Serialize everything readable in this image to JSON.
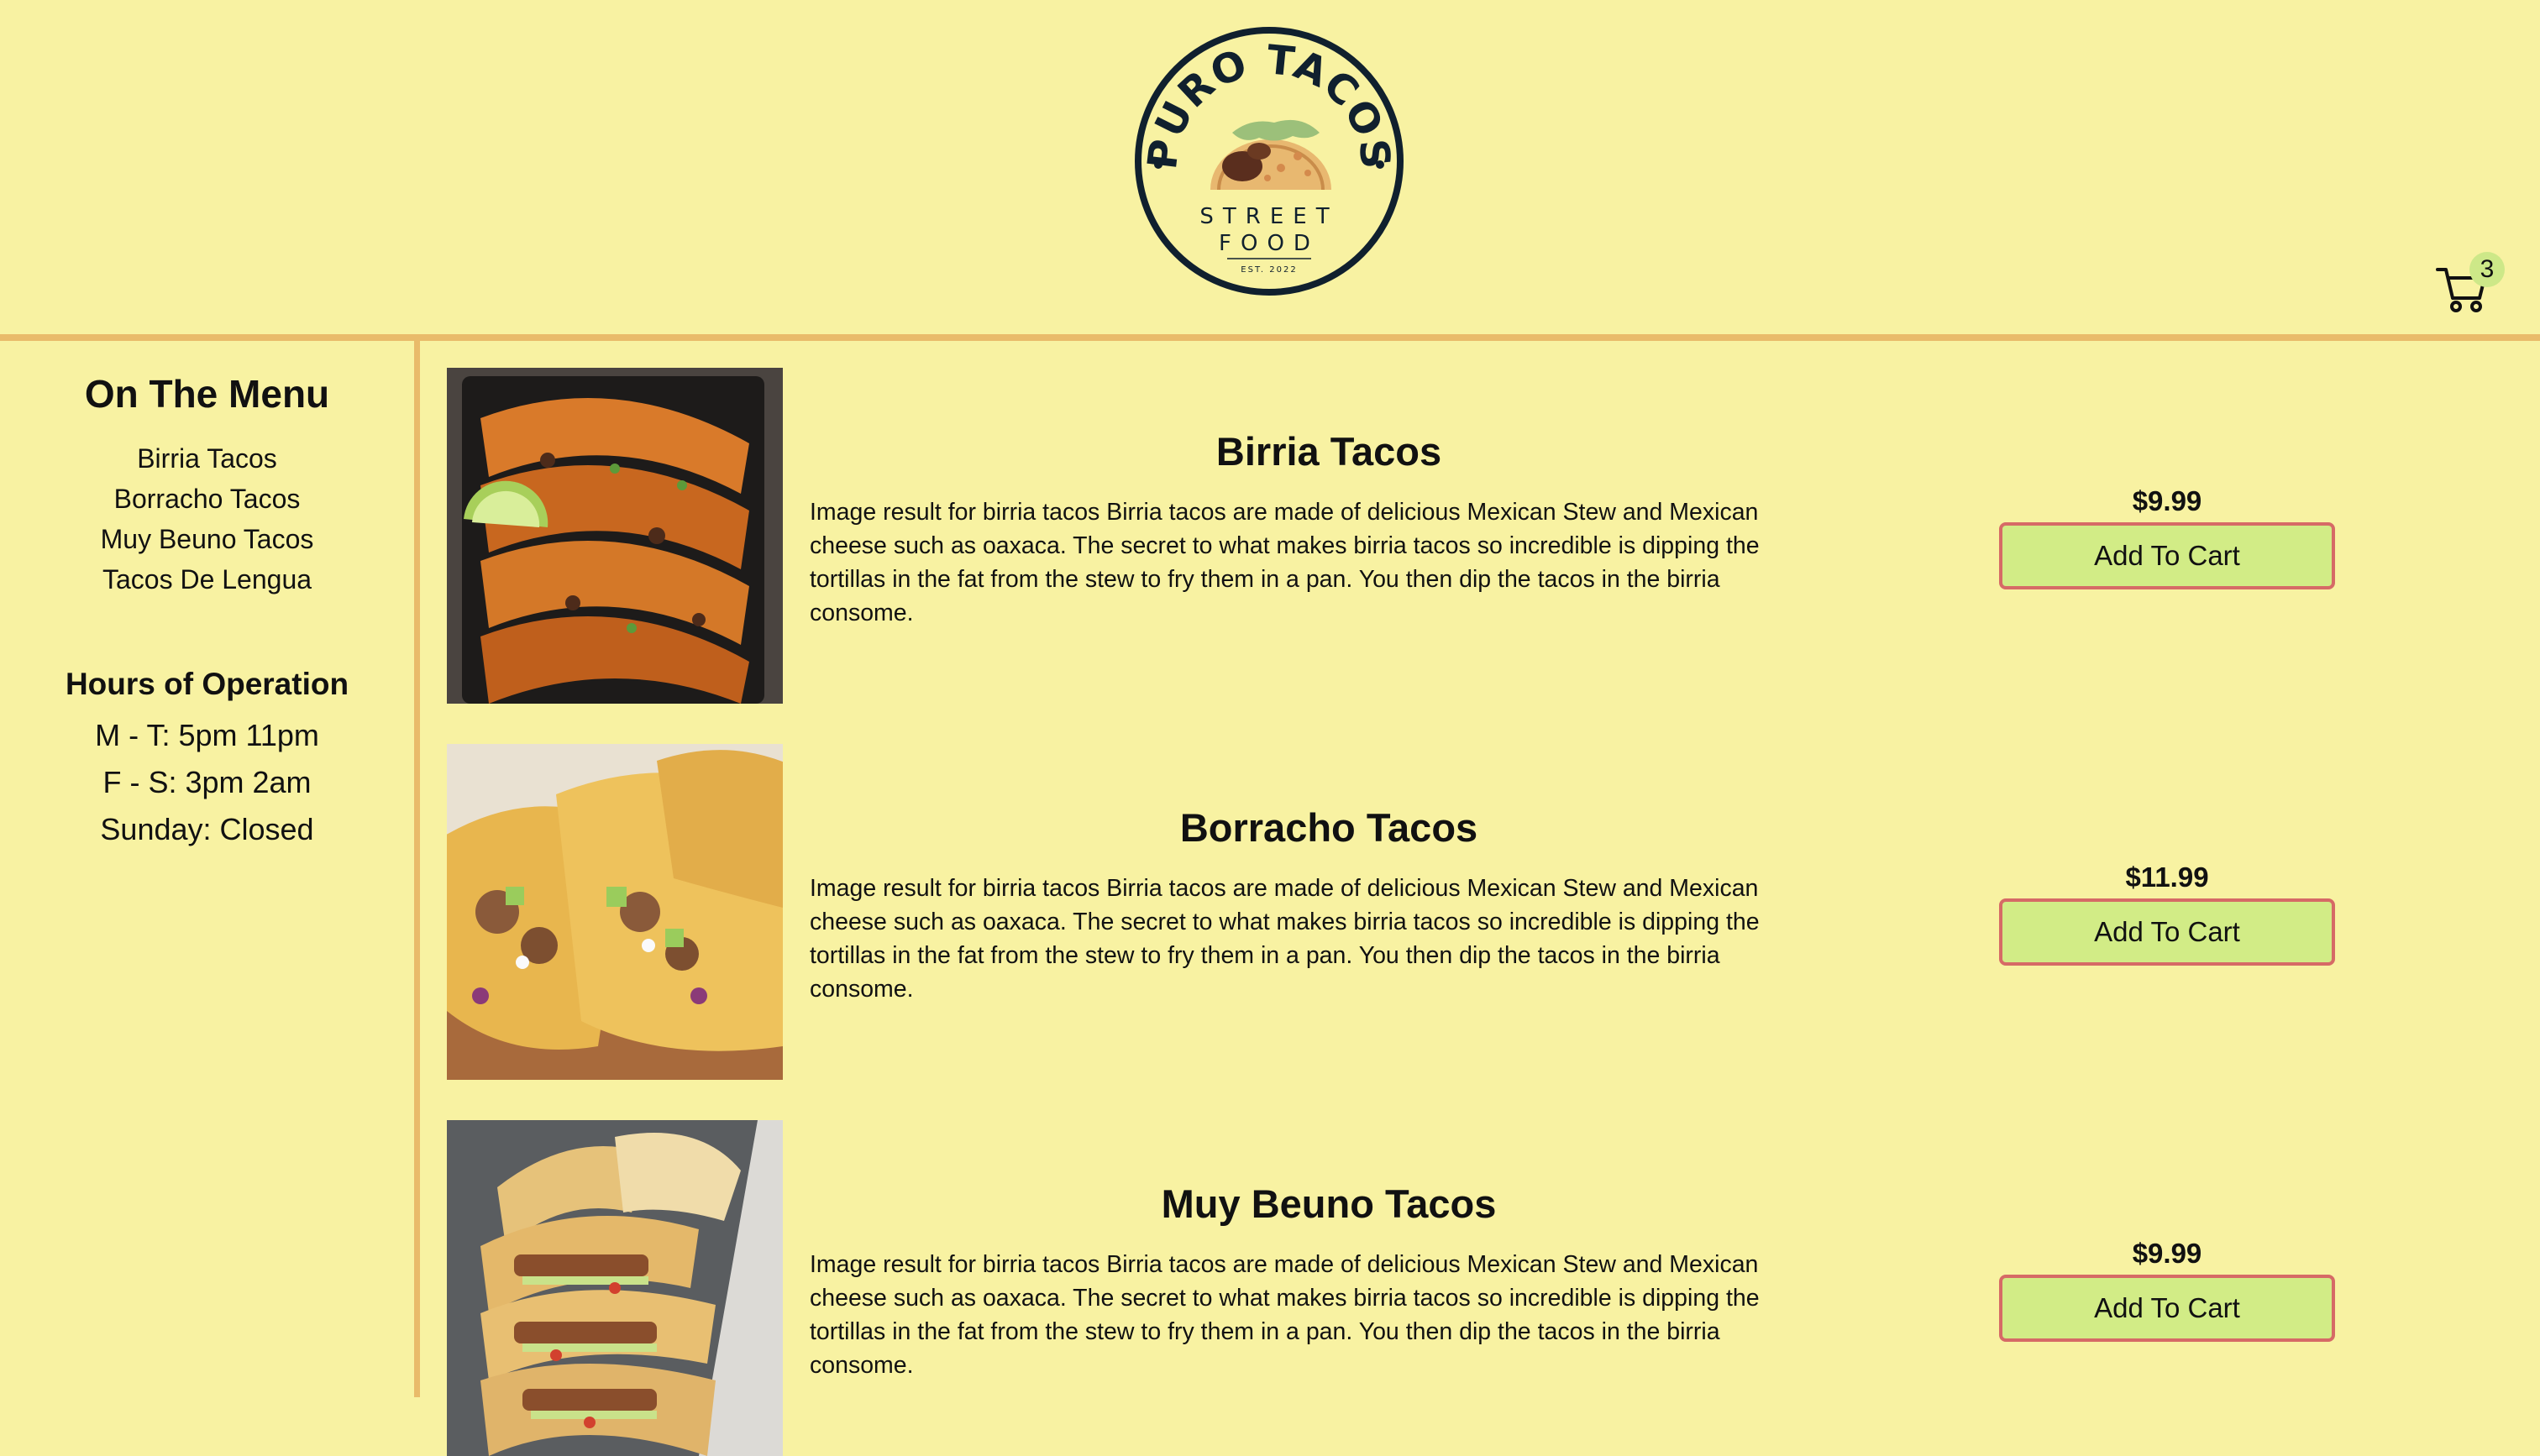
{
  "header": {
    "logo": {
      "top_text": "PURO TACOS",
      "line1": "STREET",
      "line2": "FOOD",
      "est": "EST. 2022"
    },
    "cart": {
      "icon": "cart-icon",
      "count": "3"
    }
  },
  "sidebar": {
    "menu_title": "On The Menu",
    "menu_items": [
      {
        "label": "Birria Tacos"
      },
      {
        "label": "Borracho Tacos"
      },
      {
        "label": "Muy Beuno Tacos"
      },
      {
        "label": "Tacos De Lengua"
      }
    ],
    "hours_title": "Hours of Operation",
    "hours": [
      {
        "text": "M - T: 5pm 11pm"
      },
      {
        "text": "F - S: 3pm 2am"
      },
      {
        "text": "Sunday: Closed"
      }
    ]
  },
  "items": [
    {
      "title": "Birria Tacos",
      "description": "Image result for birria tacos Birria tacos are made of delicious Mexican Stew and Mexican cheese such as oaxaca. The secret to what makes birria tacos so incredible is dipping the tortillas in the fat from the stew to fry them in a pan. You then dip the tacos in the birria consome.",
      "price": "$9.99",
      "button_label": "Add To Cart"
    },
    {
      "title": "Borracho Tacos",
      "description": "Image result for birria tacos Birria tacos are made of delicious Mexican Stew and Mexican cheese such as oaxaca. The secret to what makes birria tacos so incredible is dipping the tortillas in the fat from the stew to fry them in a pan. You then dip the tacos in the birria consome.",
      "price": "$11.99",
      "button_label": "Add To Cart"
    },
    {
      "title": "Muy Beuno Tacos",
      "description": "Image result for birria tacos Birria tacos are made of delicious Mexican Stew and Mexican cheese such as oaxaca. The secret to what makes birria tacos so incredible is dipping the tortillas in the fat from the stew to fry them in a pan. You then dip the tacos in the birria consome.",
      "price": "$9.99",
      "button_label": "Add To Cart"
    }
  ],
  "colors": {
    "background": "#f8f2a2",
    "rule": "#e9bb6a",
    "button_fill": "#d2ec86",
    "button_border": "#d66a66",
    "badge": "#cde888",
    "logo_ink": "#10202e"
  }
}
